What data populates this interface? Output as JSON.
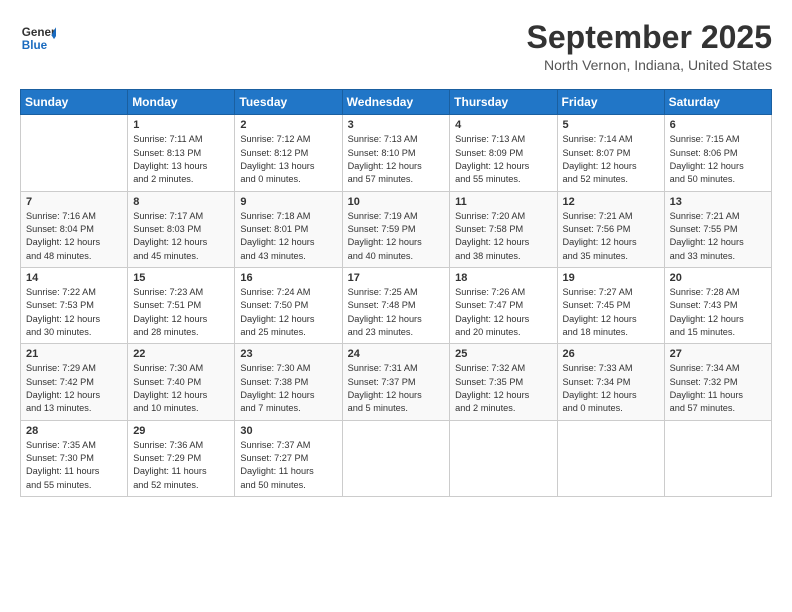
{
  "header": {
    "logo_line1": "General",
    "logo_line2": "Blue",
    "month": "September 2025",
    "location": "North Vernon, Indiana, United States"
  },
  "calendar": {
    "days_of_week": [
      "Sunday",
      "Monday",
      "Tuesday",
      "Wednesday",
      "Thursday",
      "Friday",
      "Saturday"
    ],
    "weeks": [
      [
        {
          "day": "",
          "info": ""
        },
        {
          "day": "1",
          "info": "Sunrise: 7:11 AM\nSunset: 8:13 PM\nDaylight: 13 hours\nand 2 minutes."
        },
        {
          "day": "2",
          "info": "Sunrise: 7:12 AM\nSunset: 8:12 PM\nDaylight: 13 hours\nand 0 minutes."
        },
        {
          "day": "3",
          "info": "Sunrise: 7:13 AM\nSunset: 8:10 PM\nDaylight: 12 hours\nand 57 minutes."
        },
        {
          "day": "4",
          "info": "Sunrise: 7:13 AM\nSunset: 8:09 PM\nDaylight: 12 hours\nand 55 minutes."
        },
        {
          "day": "5",
          "info": "Sunrise: 7:14 AM\nSunset: 8:07 PM\nDaylight: 12 hours\nand 52 minutes."
        },
        {
          "day": "6",
          "info": "Sunrise: 7:15 AM\nSunset: 8:06 PM\nDaylight: 12 hours\nand 50 minutes."
        }
      ],
      [
        {
          "day": "7",
          "info": "Sunrise: 7:16 AM\nSunset: 8:04 PM\nDaylight: 12 hours\nand 48 minutes."
        },
        {
          "day": "8",
          "info": "Sunrise: 7:17 AM\nSunset: 8:03 PM\nDaylight: 12 hours\nand 45 minutes."
        },
        {
          "day": "9",
          "info": "Sunrise: 7:18 AM\nSunset: 8:01 PM\nDaylight: 12 hours\nand 43 minutes."
        },
        {
          "day": "10",
          "info": "Sunrise: 7:19 AM\nSunset: 7:59 PM\nDaylight: 12 hours\nand 40 minutes."
        },
        {
          "day": "11",
          "info": "Sunrise: 7:20 AM\nSunset: 7:58 PM\nDaylight: 12 hours\nand 38 minutes."
        },
        {
          "day": "12",
          "info": "Sunrise: 7:21 AM\nSunset: 7:56 PM\nDaylight: 12 hours\nand 35 minutes."
        },
        {
          "day": "13",
          "info": "Sunrise: 7:21 AM\nSunset: 7:55 PM\nDaylight: 12 hours\nand 33 minutes."
        }
      ],
      [
        {
          "day": "14",
          "info": "Sunrise: 7:22 AM\nSunset: 7:53 PM\nDaylight: 12 hours\nand 30 minutes."
        },
        {
          "day": "15",
          "info": "Sunrise: 7:23 AM\nSunset: 7:51 PM\nDaylight: 12 hours\nand 28 minutes."
        },
        {
          "day": "16",
          "info": "Sunrise: 7:24 AM\nSunset: 7:50 PM\nDaylight: 12 hours\nand 25 minutes."
        },
        {
          "day": "17",
          "info": "Sunrise: 7:25 AM\nSunset: 7:48 PM\nDaylight: 12 hours\nand 23 minutes."
        },
        {
          "day": "18",
          "info": "Sunrise: 7:26 AM\nSunset: 7:47 PM\nDaylight: 12 hours\nand 20 minutes."
        },
        {
          "day": "19",
          "info": "Sunrise: 7:27 AM\nSunset: 7:45 PM\nDaylight: 12 hours\nand 18 minutes."
        },
        {
          "day": "20",
          "info": "Sunrise: 7:28 AM\nSunset: 7:43 PM\nDaylight: 12 hours\nand 15 minutes."
        }
      ],
      [
        {
          "day": "21",
          "info": "Sunrise: 7:29 AM\nSunset: 7:42 PM\nDaylight: 12 hours\nand 13 minutes."
        },
        {
          "day": "22",
          "info": "Sunrise: 7:30 AM\nSunset: 7:40 PM\nDaylight: 12 hours\nand 10 minutes."
        },
        {
          "day": "23",
          "info": "Sunrise: 7:30 AM\nSunset: 7:38 PM\nDaylight: 12 hours\nand 7 minutes."
        },
        {
          "day": "24",
          "info": "Sunrise: 7:31 AM\nSunset: 7:37 PM\nDaylight: 12 hours\nand 5 minutes."
        },
        {
          "day": "25",
          "info": "Sunrise: 7:32 AM\nSunset: 7:35 PM\nDaylight: 12 hours\nand 2 minutes."
        },
        {
          "day": "26",
          "info": "Sunrise: 7:33 AM\nSunset: 7:34 PM\nDaylight: 12 hours\nand 0 minutes."
        },
        {
          "day": "27",
          "info": "Sunrise: 7:34 AM\nSunset: 7:32 PM\nDaylight: 11 hours\nand 57 minutes."
        }
      ],
      [
        {
          "day": "28",
          "info": "Sunrise: 7:35 AM\nSunset: 7:30 PM\nDaylight: 11 hours\nand 55 minutes."
        },
        {
          "day": "29",
          "info": "Sunrise: 7:36 AM\nSunset: 7:29 PM\nDaylight: 11 hours\nand 52 minutes."
        },
        {
          "day": "30",
          "info": "Sunrise: 7:37 AM\nSunset: 7:27 PM\nDaylight: 11 hours\nand 50 minutes."
        },
        {
          "day": "",
          "info": ""
        },
        {
          "day": "",
          "info": ""
        },
        {
          "day": "",
          "info": ""
        },
        {
          "day": "",
          "info": ""
        }
      ]
    ]
  }
}
